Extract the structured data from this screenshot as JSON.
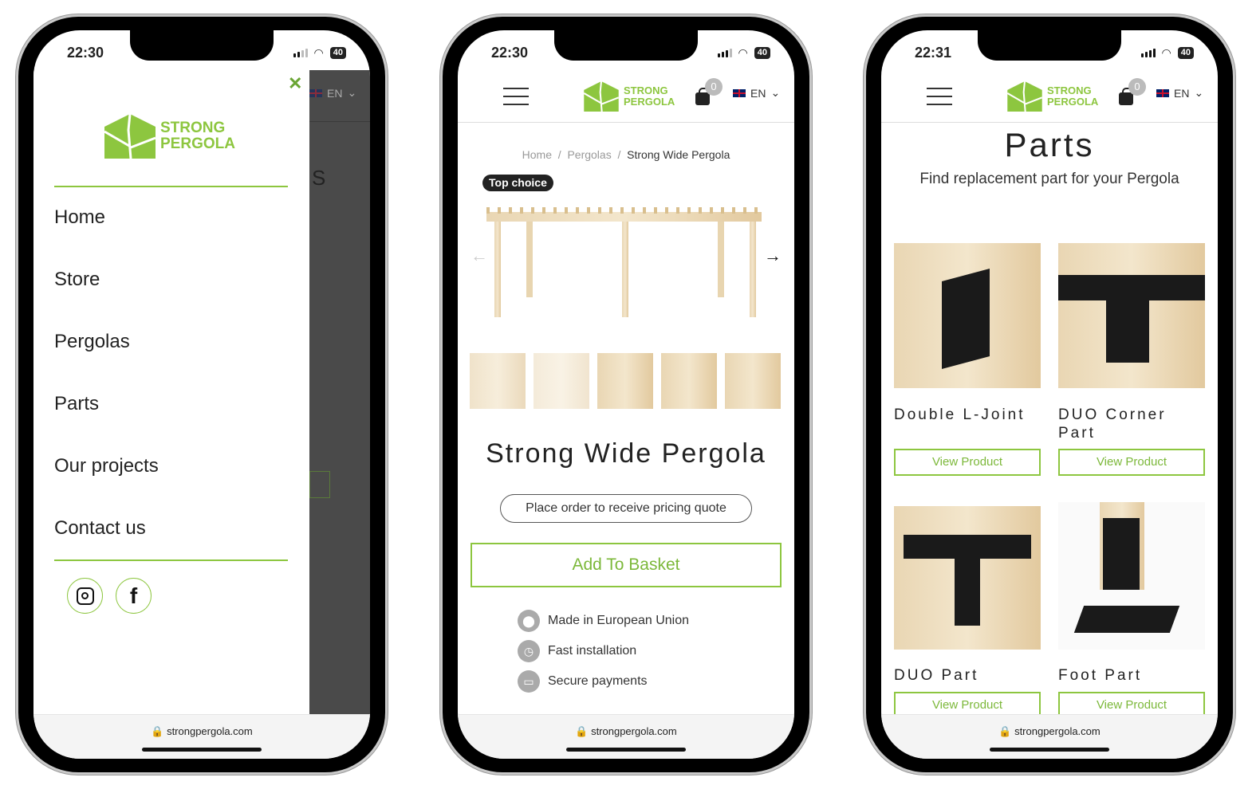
{
  "brand": {
    "line1": "STRONG",
    "line2": "PERGOLA",
    "color": "#8dc63f"
  },
  "url": "strongpergola.com",
  "lang": "EN",
  "phones": [
    {
      "time": "22:30",
      "battery": "40",
      "menu": {
        "items": [
          "Home",
          "Store",
          "Pergolas",
          "Parts",
          "Our projects",
          "Contact us"
        ],
        "close_icon": "close-icon",
        "social": [
          "instagram-icon",
          "facebook-icon"
        ],
        "behind_letter": "S"
      }
    },
    {
      "time": "22:30",
      "battery": "40",
      "cart_count": "0",
      "breadcrumb": [
        "Home",
        "Pergolas",
        "Strong Wide Pergola"
      ],
      "badge": "Top choice",
      "title": "Strong Wide Pergola",
      "quote_label": "Place order to receive pricing quote",
      "add_label": "Add To Basket",
      "features": [
        {
          "icon": "location-pin-icon",
          "label": "Made in European Union"
        },
        {
          "icon": "clock-icon",
          "label": "Fast installation"
        },
        {
          "icon": "credit-card-icon",
          "label": "Secure payments"
        }
      ]
    },
    {
      "time": "22:31",
      "battery": "40",
      "cart_count": "0",
      "title": "Parts",
      "subtitle": "Find replacement part for your Pergola",
      "products": [
        {
          "name": "Double L-Joint",
          "button": "View Product"
        },
        {
          "name": "DUO Corner Part",
          "button": "View Product"
        },
        {
          "name": "DUO Part",
          "button": "View Product"
        },
        {
          "name": "Foot Part",
          "button": "View Product"
        }
      ]
    }
  ]
}
